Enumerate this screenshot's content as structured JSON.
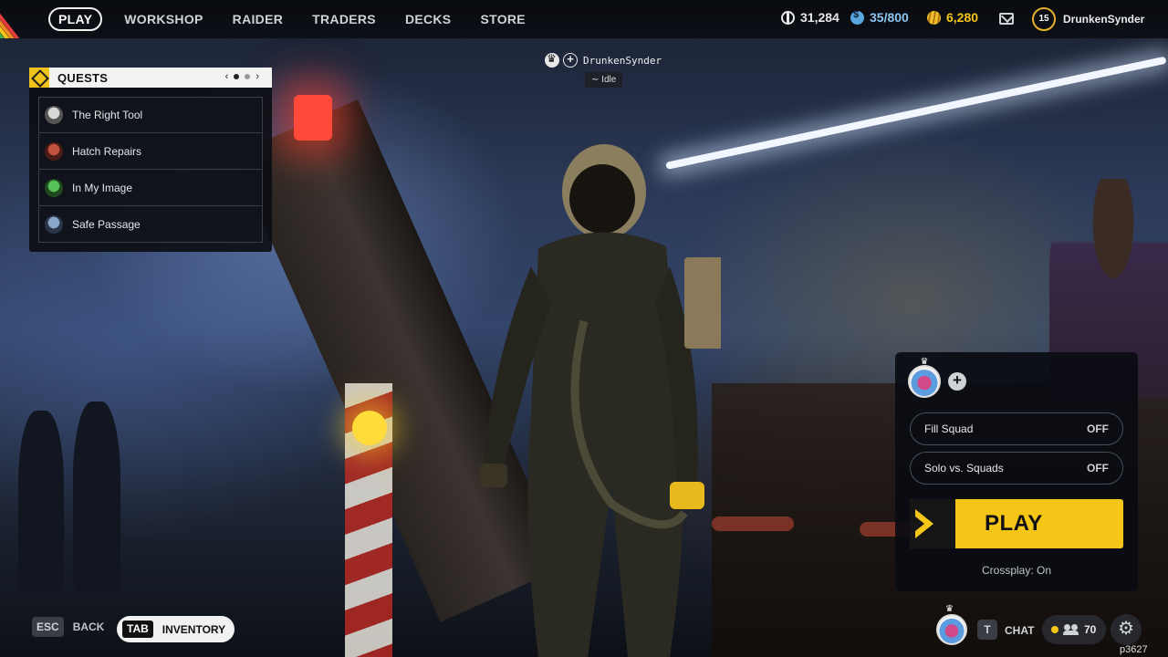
{
  "nav": {
    "items": [
      "PLAY",
      "WORKSHOP",
      "RAIDER",
      "TRADERS",
      "DECKS",
      "STORE"
    ],
    "active": "PLAY"
  },
  "currencies": {
    "credits": "31,284",
    "coins": "35/800",
    "tokens": "6,280"
  },
  "profile": {
    "level": "15",
    "name": "DrunkenSynder",
    "icons": [
      "mail-icon",
      "level-badge"
    ]
  },
  "quests": {
    "title": "QUESTS",
    "items": [
      {
        "label": "The Right Tool",
        "color": "#c9c9c9"
      },
      {
        "label": "Hatch Repairs",
        "color": "#b5483a"
      },
      {
        "label": "In My Image",
        "color": "#46a646"
      },
      {
        "label": "Safe Passage",
        "color": "#6a8ab0"
      }
    ]
  },
  "party": {
    "name": "DrunkenSynder",
    "status": "Idle"
  },
  "squad": {
    "fill_squad_label": "Fill Squad",
    "fill_squad_value": "OFF",
    "solo_label": "Solo vs. Squads",
    "solo_value": "OFF",
    "play_label": "PLAY",
    "crossplay": "Crossplay: On"
  },
  "bottom": {
    "esc_key": "ESC",
    "back_label": "BACK",
    "tab_key": "TAB",
    "inventory_label": "INVENTORY",
    "chat_key": "T",
    "chat_label": "CHAT",
    "friends_count": "70",
    "build_id": "p3627"
  },
  "colors": {
    "accent": "#f5c518",
    "coins": "#5aa6e0",
    "rainbow": [
      "#e23b3b",
      "#f08a24",
      "#f5c518",
      "#3fae49",
      "#3a7bd5"
    ]
  }
}
